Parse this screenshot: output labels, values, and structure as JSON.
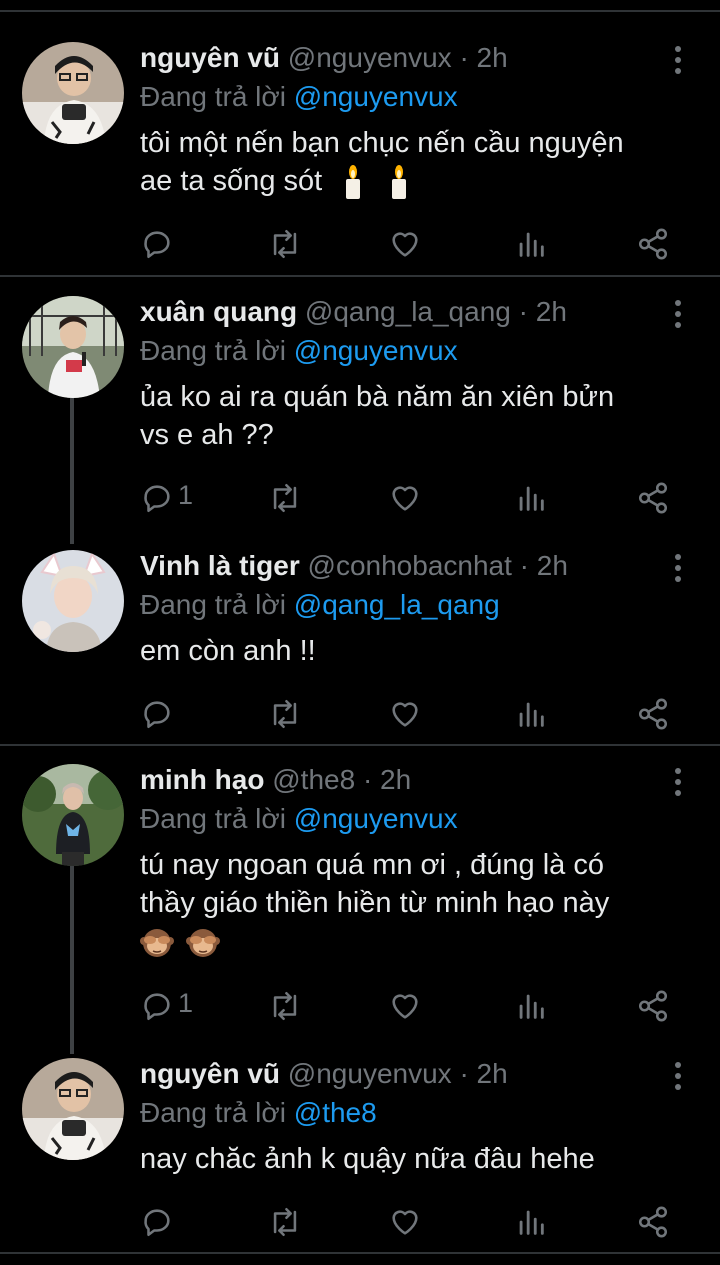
{
  "tweets": [
    {
      "name": "nguyên vũ",
      "handle": "@nguyenvux",
      "dot": "·",
      "time": "2h",
      "replying_prefix": "Đang trả lời",
      "replying_to": "@nguyenvux",
      "text_lines": [
        "tôi một nến bạn chục nến cầu nguyện",
        "ae ta sống sót"
      ],
      "emoji": [
        "candle",
        "candle"
      ],
      "reply_count": ""
    },
    {
      "name": "xuân quang",
      "handle": "@qang_la_qang",
      "dot": "·",
      "time": "2h",
      "replying_prefix": "Đang trả lời",
      "replying_to": "@nguyenvux",
      "text_lines": [
        "ủa ko ai ra quán bà năm ăn xiên bửn",
        "vs e ah ??"
      ],
      "reply_count": "1"
    },
    {
      "name": "Vinh là tiger",
      "handle": "@conhobacnhat",
      "dot": "·",
      "time": "2h",
      "replying_prefix": "Đang trả lời",
      "replying_to": "@qang_la_qang",
      "text_lines": [
        "em còn anh !!"
      ],
      "reply_count": ""
    },
    {
      "name": "minh hạo",
      "handle": "@the8",
      "dot": "·",
      "time": "2h",
      "replying_prefix": "Đang trả lời",
      "replying_to": "@nguyenvux",
      "text_lines": [
        "tú nay ngoan quá mn ơi , đúng là có",
        "thầy giáo thiền hiền từ minh hạo này"
      ],
      "emoji": [
        "see-no-evil-monkey",
        "see-no-evil-monkey"
      ],
      "reply_count": "1"
    },
    {
      "name": "nguyên vũ",
      "handle": "@nguyenvux",
      "dot": "·",
      "time": "2h",
      "replying_prefix": "Đang trả lời",
      "replying_to": "@the8",
      "text_lines": [
        "nay chăc ảnh k quậy nữa đâu hehe"
      ],
      "reply_count": ""
    }
  ],
  "icons": {
    "reply": "reply-icon",
    "retweet": "retweet-icon",
    "like": "heart-icon",
    "views": "analytics-icon",
    "share": "share-icon",
    "more": "more-icon"
  },
  "colors": {
    "background": "#000000",
    "text": "#e7e9ea",
    "secondary": "#71767b",
    "accent": "#1d9bf0",
    "divider": "#2f3336"
  }
}
